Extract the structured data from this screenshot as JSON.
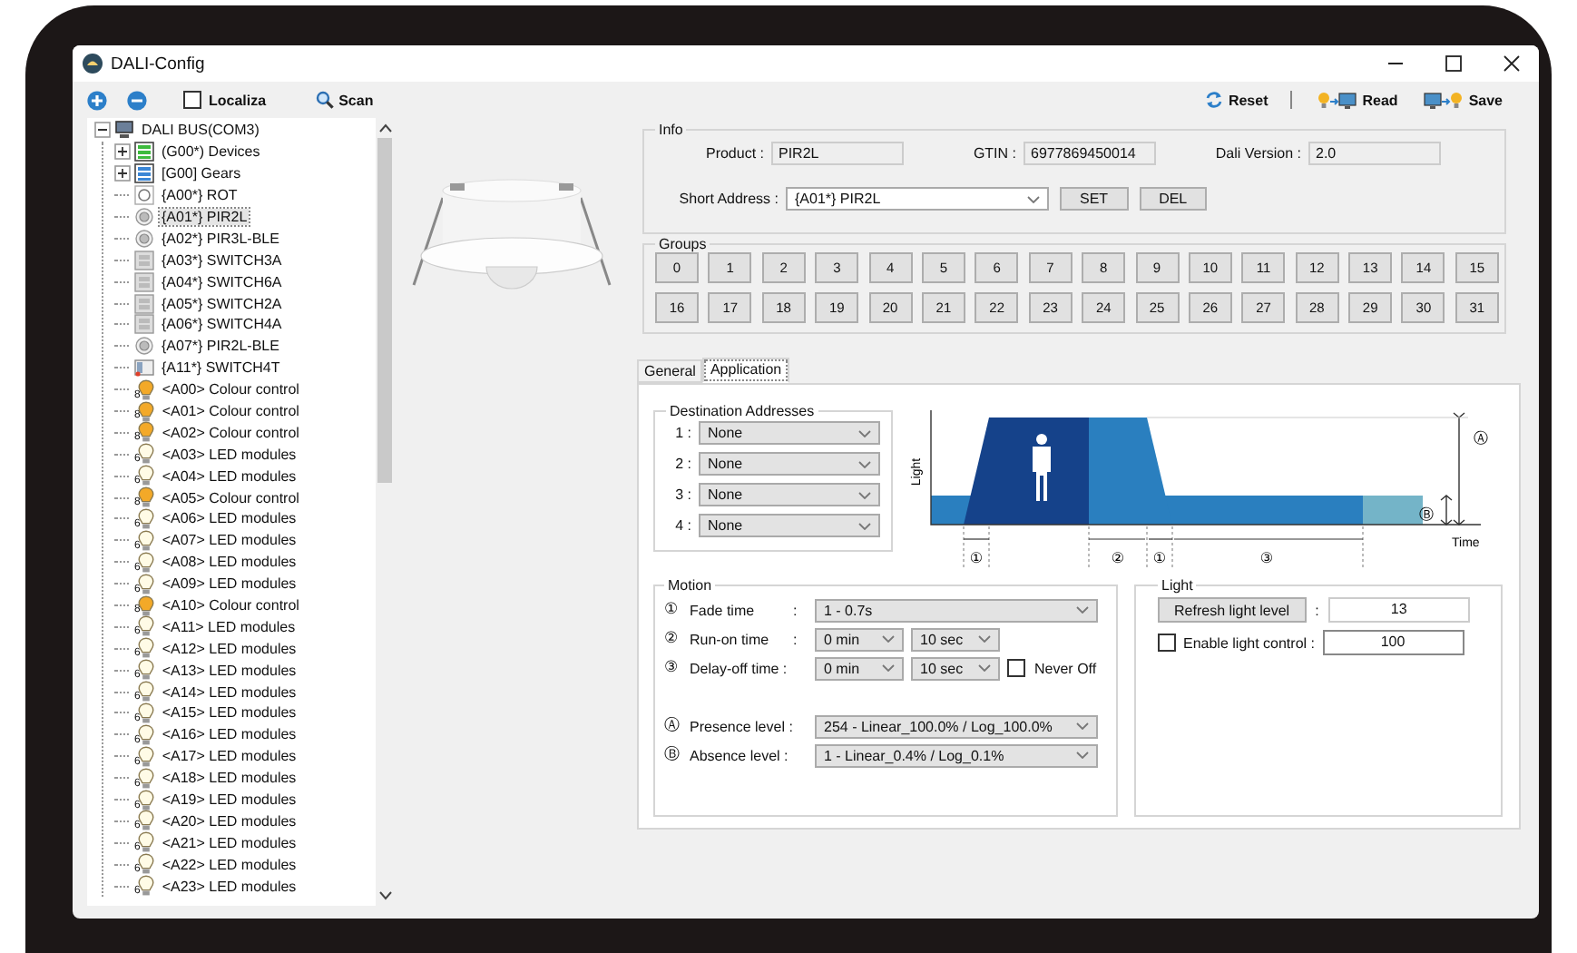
{
  "window": {
    "title": "DALI-Config"
  },
  "toolbar": {
    "localiza": {
      "label": "Localiza",
      "checked": false
    },
    "scan": "Scan",
    "reset": "Reset",
    "read": "Read",
    "save": "Save"
  },
  "tree": {
    "label": "DALI BUS(COM3)",
    "kind": "bus",
    "expanded": true,
    "selected": false,
    "children": [
      {
        "label": "(G00*) Devices",
        "kind": "devices",
        "expanded": false,
        "selected": false
      },
      {
        "label": "[G00] Gears",
        "kind": "gears",
        "expanded": false,
        "selected": false
      },
      {
        "label": "{A00*} ROT",
        "kind": "round",
        "selected": false
      },
      {
        "label": "{A01*} PIR2L",
        "kind": "sensor",
        "selected": true
      },
      {
        "label": "{A02*} PIR3L-BLE",
        "kind": "sensor",
        "selected": false
      },
      {
        "label": "{A03*} SWITCH3A",
        "kind": "switch",
        "selected": false
      },
      {
        "label": "{A04*} SWITCH6A",
        "kind": "switch",
        "selected": false
      },
      {
        "label": "{A05*} SWITCH2A",
        "kind": "switch",
        "selected": false
      },
      {
        "label": "{A06*} SWITCH4A",
        "kind": "switch",
        "selected": false
      },
      {
        "label": "{A07*} PIR2L-BLE",
        "kind": "sensor",
        "selected": false
      },
      {
        "label": "{A11*} SWITCH4T",
        "kind": "touch",
        "selected": false
      },
      {
        "label": "<A00> Colour control",
        "kind": "colour",
        "badge": "8",
        "selected": false
      },
      {
        "label": "<A01> Colour control",
        "kind": "colour",
        "badge": "8",
        "selected": false
      },
      {
        "label": "<A02> Colour control",
        "kind": "colour",
        "badge": "8",
        "selected": false
      },
      {
        "label": "<A03> LED modules",
        "kind": "led",
        "badge": "6",
        "selected": false
      },
      {
        "label": "<A04> LED modules",
        "kind": "led",
        "badge": "6",
        "selected": false
      },
      {
        "label": "<A05> Colour control",
        "kind": "colour",
        "badge": "8",
        "selected": false
      },
      {
        "label": "<A06> LED modules",
        "kind": "led",
        "badge": "6",
        "selected": false
      },
      {
        "label": "<A07> LED modules",
        "kind": "led",
        "badge": "6",
        "selected": false
      },
      {
        "label": "<A08> LED modules",
        "kind": "led",
        "badge": "6",
        "selected": false
      },
      {
        "label": "<A09> LED modules",
        "kind": "led",
        "badge": "6",
        "selected": false
      },
      {
        "label": "<A10> Colour control",
        "kind": "colour",
        "badge": "8",
        "selected": false
      },
      {
        "label": "<A11> LED modules",
        "kind": "led",
        "badge": "6",
        "selected": false
      },
      {
        "label": "<A12> LED modules",
        "kind": "led",
        "badge": "6",
        "selected": false
      },
      {
        "label": "<A13> LED modules",
        "kind": "led",
        "badge": "6",
        "selected": false
      },
      {
        "label": "<A14> LED modules",
        "kind": "led",
        "badge": "6",
        "selected": false
      },
      {
        "label": "<A15> LED modules",
        "kind": "led",
        "badge": "6",
        "selected": false
      },
      {
        "label": "<A16> LED modules",
        "kind": "led",
        "badge": "6",
        "selected": false
      },
      {
        "label": "<A17> LED modules",
        "kind": "led",
        "badge": "6",
        "selected": false
      },
      {
        "label": "<A18> LED modules",
        "kind": "led",
        "badge": "6",
        "selected": false
      },
      {
        "label": "<A19> LED modules",
        "kind": "led",
        "badge": "6",
        "selected": false
      },
      {
        "label": "<A20> LED modules",
        "kind": "led",
        "badge": "6",
        "selected": false
      },
      {
        "label": "<A21> LED modules",
        "kind": "led",
        "badge": "6",
        "selected": false
      },
      {
        "label": "<A22> LED modules",
        "kind": "led",
        "badge": "6",
        "selected": false
      },
      {
        "label": "<A23> LED modules",
        "kind": "led",
        "badge": "6",
        "selected": false
      }
    ]
  },
  "info": {
    "title": "Info",
    "product_label": "Product :",
    "product": "PIR2L",
    "gtin_label": "GTIN :",
    "gtin": "6977869450014",
    "version_label": "Dali Version :",
    "version": "2.0",
    "short_address_label": "Short Address :",
    "short_address": "{A01*} PIR2L",
    "set": "SET",
    "del": "DEL"
  },
  "groups": {
    "title": "Groups",
    "items": [
      "0",
      "1",
      "2",
      "3",
      "4",
      "5",
      "6",
      "7",
      "8",
      "9",
      "10",
      "11",
      "12",
      "13",
      "14",
      "15",
      "16",
      "17",
      "18",
      "19",
      "20",
      "21",
      "22",
      "23",
      "24",
      "25",
      "26",
      "27",
      "28",
      "29",
      "30",
      "31"
    ]
  },
  "tabs": [
    {
      "label": "General",
      "selected": false
    },
    {
      "label": "Application",
      "selected": true
    }
  ],
  "destination": {
    "title": "Destination Addresses",
    "rows": [
      {
        "label": "1 :",
        "value": "None"
      },
      {
        "label": "2 :",
        "value": "None"
      },
      {
        "label": "3 :",
        "value": "None"
      },
      {
        "label": "4 :",
        "value": "None"
      }
    ]
  },
  "diagram": {
    "ylabel": "Light",
    "xlabel": "Time",
    "marks": [
      "①",
      "②",
      "①",
      "③"
    ],
    "presence_mark": "Ⓐ",
    "absence_mark": "Ⓑ"
  },
  "motion": {
    "title": "Motion",
    "rows": [
      {
        "kind": "time",
        "marker": "①",
        "label": "Fade time",
        "colon": ":",
        "selects": [
          "1 - 0.7s"
        ]
      },
      {
        "kind": "time",
        "marker": "②",
        "label": "Run-on time",
        "colon": ":",
        "selects": [
          "0 min",
          "10 sec"
        ]
      },
      {
        "kind": "time",
        "marker": "③",
        "label": "Delay-off time :",
        "selects": [
          "0 min",
          "10 sec"
        ],
        "checkbox": {
          "label": "Never Off",
          "checked": false
        }
      },
      {
        "kind": "level",
        "marker": "Ⓐ",
        "label": "Presence level :",
        "selects": [
          "254 - Linear_100.0% / Log_100.0%"
        ]
      },
      {
        "kind": "level",
        "marker": "Ⓑ",
        "label": "Absence level :",
        "selects": [
          "1 - Linear_0.4% / Log_0.1%"
        ]
      }
    ]
  },
  "light": {
    "title": "Light",
    "refresh": "Refresh light level",
    "colon": ":",
    "level_value": "13",
    "enable": {
      "label": "Enable light control :",
      "checked": false
    },
    "enable_value": "100"
  }
}
